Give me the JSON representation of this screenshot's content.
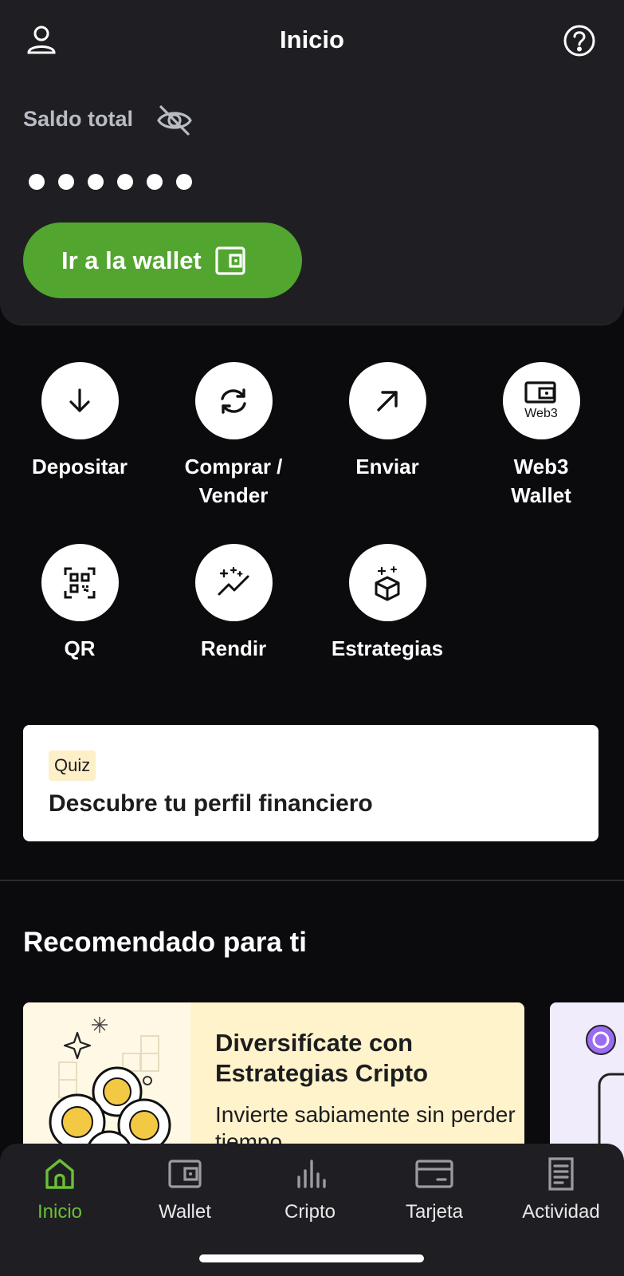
{
  "header": {
    "title": "Inicio"
  },
  "balance": {
    "label": "Saldo total",
    "masked_value": "●●●●●●"
  },
  "wallet_button": {
    "label": "Ir a la wallet"
  },
  "actions": [
    {
      "label": "Depositar",
      "icon": "arrow-down-icon"
    },
    {
      "label": "Comprar /\nVender",
      "icon": "swap-icon"
    },
    {
      "label": "Enviar",
      "icon": "arrow-up-right-icon"
    },
    {
      "label": "Web3\nWallet",
      "icon": "web3-wallet-icon",
      "icon_text": "Web3"
    },
    {
      "label": "QR",
      "icon": "qr-icon"
    },
    {
      "label": "Rendir",
      "icon": "trend-sparkle-icon"
    },
    {
      "label": "Estrategias",
      "icon": "cube-sparkle-icon"
    }
  ],
  "quiz": {
    "badge": "Quiz",
    "title": "Descubre tu perfil financiero"
  },
  "recommended": {
    "title": "Recomendado para ti",
    "cards": [
      {
        "title": "Diversifícate con Estrategias Cripto",
        "description": "Invierte sabiamente sin perder tiempo"
      }
    ]
  },
  "nav": [
    {
      "label": "Inicio",
      "icon": "home-icon",
      "active": true
    },
    {
      "label": "Wallet",
      "icon": "wallet-icon",
      "active": false
    },
    {
      "label": "Cripto",
      "icon": "bar-chart-icon",
      "active": false
    },
    {
      "label": "Tarjeta",
      "icon": "card-icon",
      "active": false
    },
    {
      "label": "Actividad",
      "icon": "document-icon",
      "active": false
    }
  ],
  "colors": {
    "accent_green": "#52a52f",
    "nav_active": "#6bbf35",
    "background": "#0b0b0e",
    "card": "#1f1f23"
  }
}
